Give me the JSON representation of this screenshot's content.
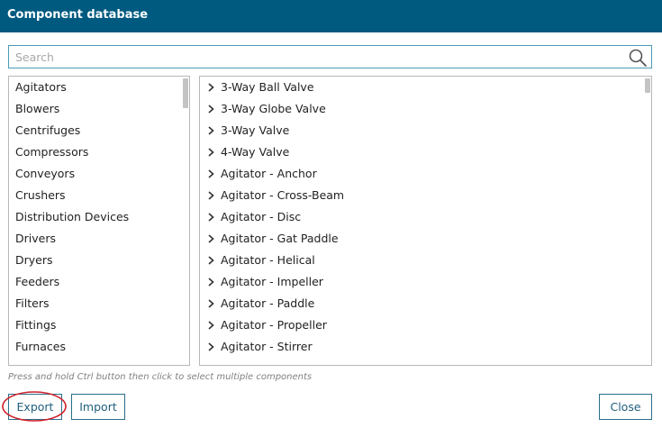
{
  "window": {
    "title": "Component database"
  },
  "search": {
    "placeholder": "Search",
    "value": ""
  },
  "categories": [
    "Agitators",
    "Blowers",
    "Centrifuges",
    "Compressors",
    "Conveyors",
    "Crushers",
    "Distribution Devices",
    "Drivers",
    "Dryers",
    "Feeders",
    "Filters",
    "Fittings",
    "Furnaces"
  ],
  "components": [
    "3-Way Ball Valve",
    "3-Way Globe Valve",
    "3-Way Valve",
    "4-Way Valve",
    "Agitator - Anchor",
    "Agitator - Cross-Beam",
    "Agitator - Disc",
    "Agitator - Gat Paddle",
    "Agitator - Helical",
    "Agitator - Impeller",
    "Agitator - Paddle",
    "Agitator - Propeller",
    "Agitator - Stirrer"
  ],
  "hint": "Press and hold Ctrl button then click to select multiple components",
  "buttons": {
    "export": "Export",
    "import": "Import",
    "close": "Close"
  },
  "colors": {
    "titlebar": "#005a80",
    "annotation": "#d0202a",
    "button_border": "#2a6e8c"
  }
}
